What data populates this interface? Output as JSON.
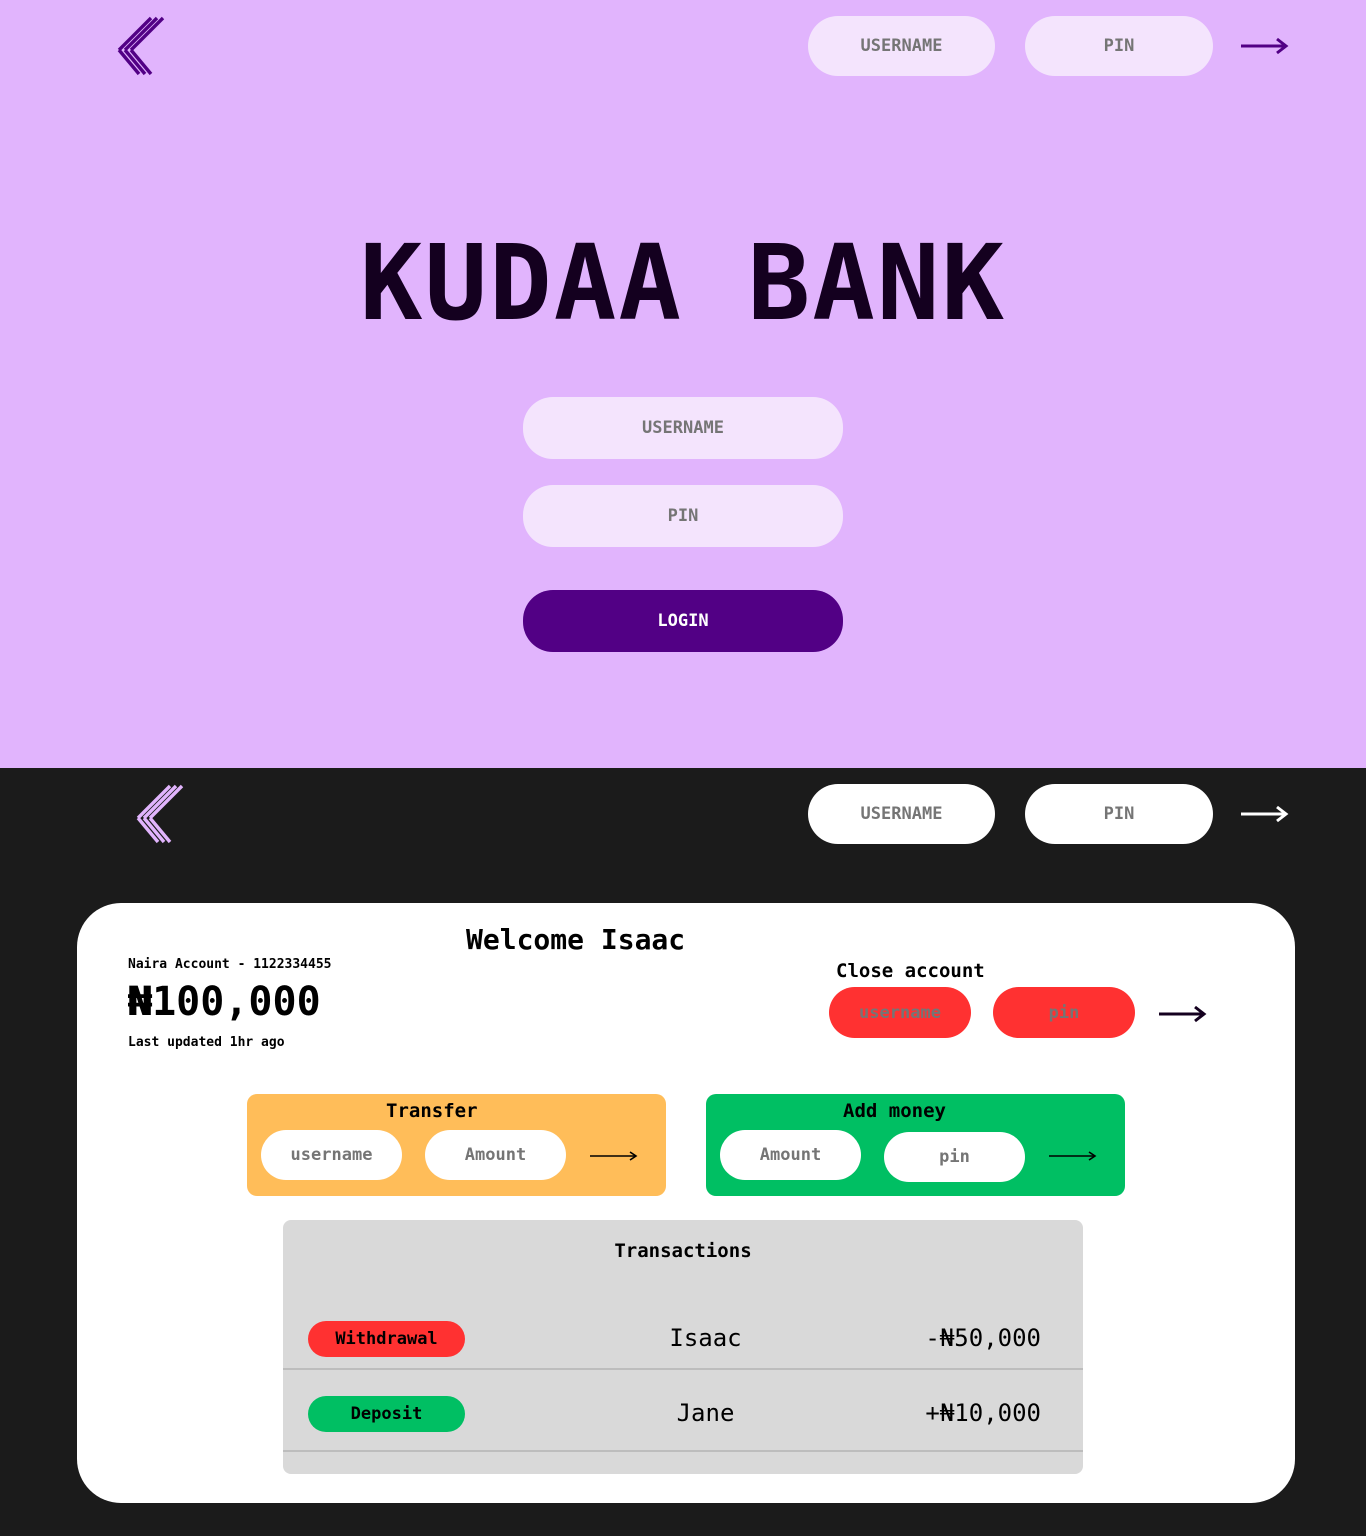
{
  "login_page": {
    "header": {
      "logo_icon": "kudaa-k-logo-icon",
      "username_placeholder": "USERNAME",
      "pin_placeholder": "PIN",
      "submit_icon": "arrow-right-icon"
    },
    "title": "KUDAA BANK",
    "form": {
      "username_placeholder": "USERNAME",
      "pin_placeholder": "PIN",
      "login_label": "LOGIN"
    }
  },
  "dashboard_page": {
    "header": {
      "logo_icon": "kudaa-k-logo-icon",
      "username_placeholder": "USERNAME",
      "pin_placeholder": "PIN",
      "submit_icon": "arrow-right-icon"
    },
    "welcome": "Welcome Isaac",
    "account": {
      "label": "Naira Account - 1122334455",
      "balance": "₦100,000",
      "last_updated": "Last updated 1hr ago"
    },
    "close_account": {
      "title": "Close account",
      "username_placeholder": "username",
      "pin_placeholder": "pin"
    },
    "transfer": {
      "title": "Transfer",
      "username_placeholder": "username",
      "amount_placeholder": "Amount"
    },
    "add_money": {
      "title": "Add money",
      "amount_placeholder": "Amount",
      "pin_placeholder": "pin"
    },
    "transactions": {
      "title": "Transactions",
      "rows": [
        {
          "type": "Withdrawal",
          "name": "Isaac",
          "amount": "-₦50,000",
          "color": "#ff3131"
        },
        {
          "type": "Deposit",
          "name": "Jane",
          "amount": "+₦10,000",
          "color": "#00bf63"
        }
      ]
    }
  },
  "colors": {
    "login_bg": "#e1b4fd",
    "input_light": "#f4e4fd",
    "brand_purple": "#520085",
    "dark_bg": "#1b1b1b",
    "danger_red": "#ff3131",
    "transfer_orange": "#ffbd59",
    "success_green": "#00bf63",
    "table_grey": "#d9d9d9"
  }
}
